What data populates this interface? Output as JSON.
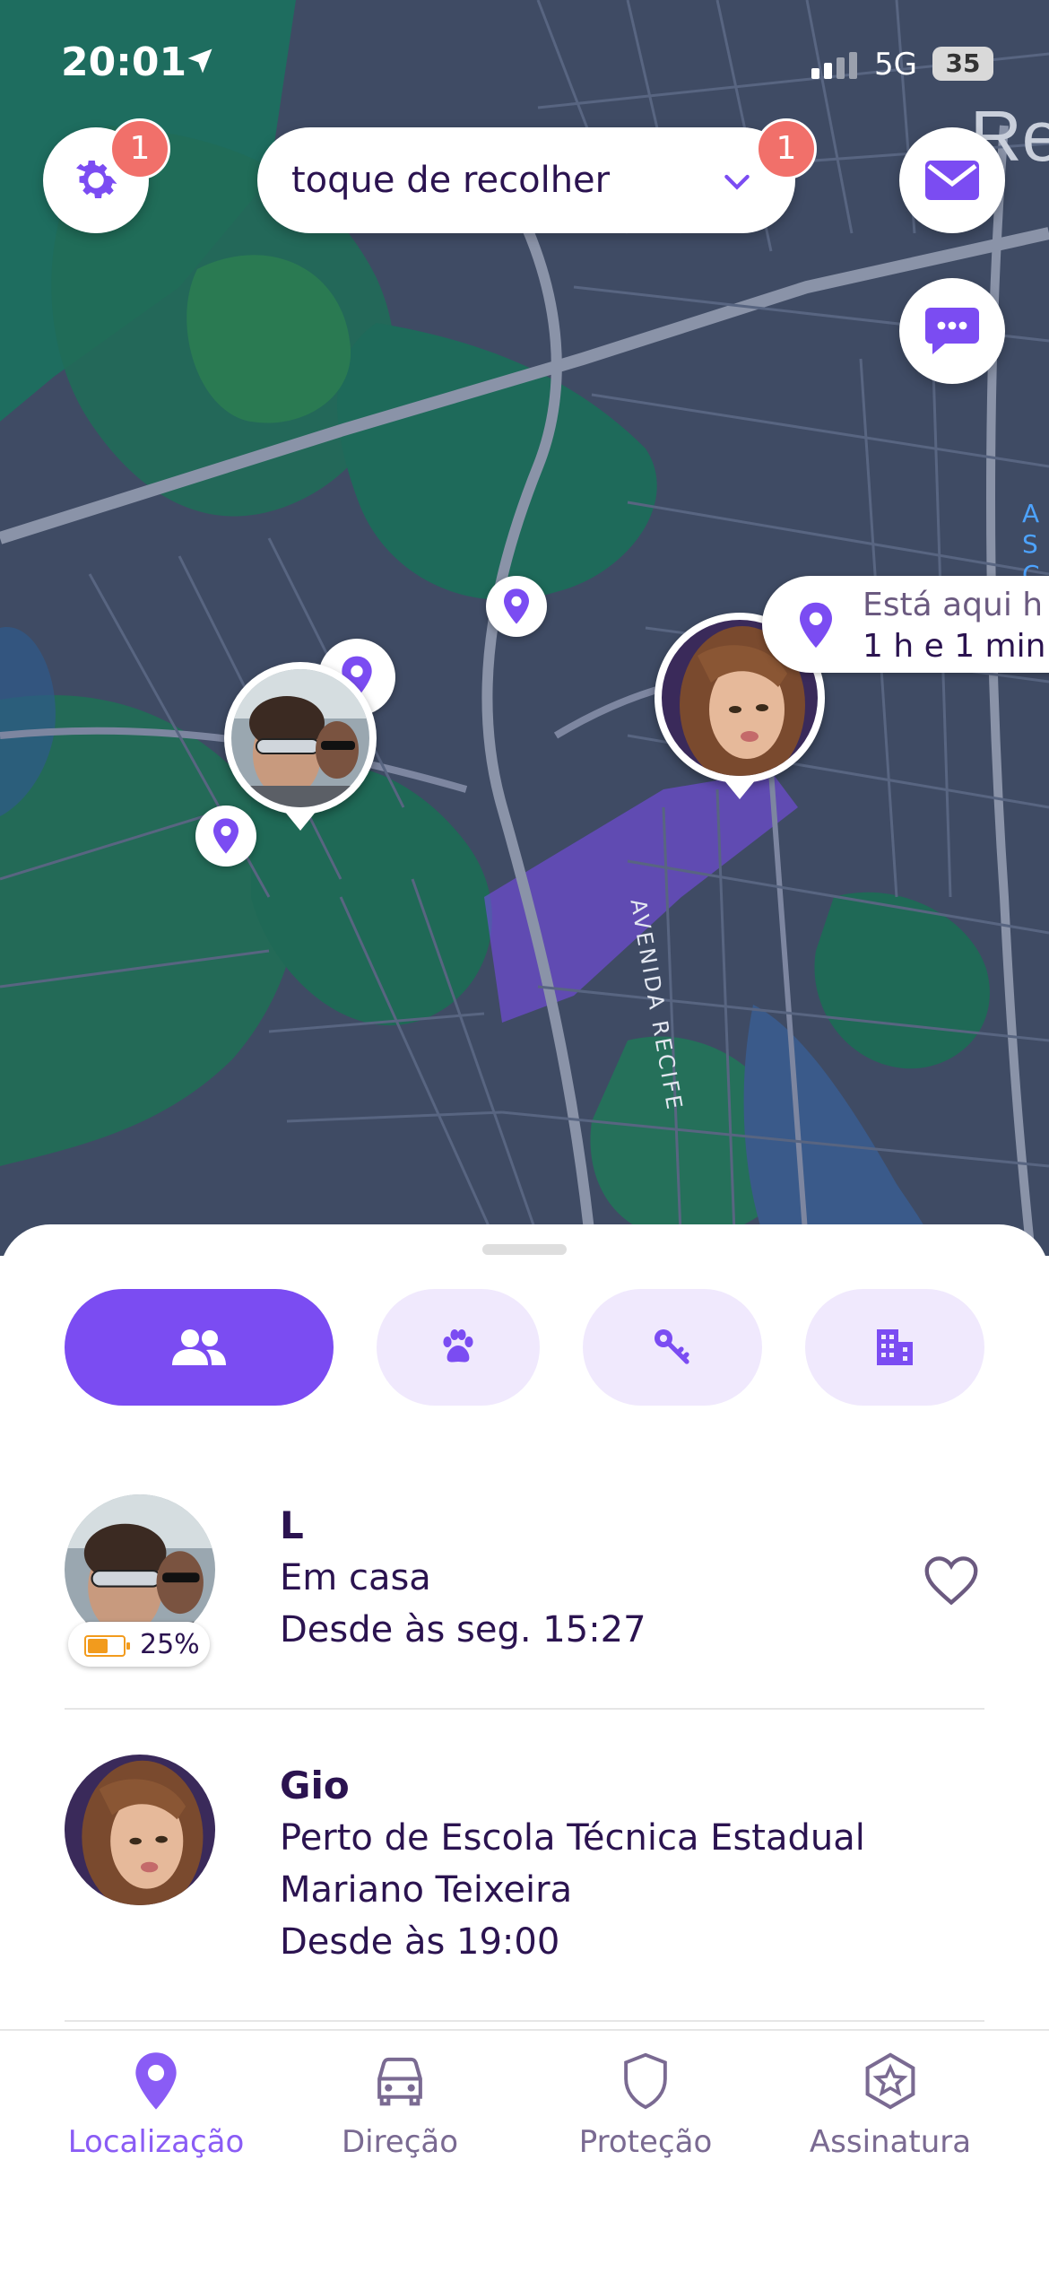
{
  "status_bar": {
    "time": "20:01",
    "network": "5G",
    "battery": "35"
  },
  "map": {
    "label_top_right": "Re",
    "street_label": "AVENIDA RECIFE",
    "side_label": "A S C"
  },
  "header": {
    "settings_badge": "1",
    "circle_dropdown": {
      "label": "toque de recolher",
      "badge": "1"
    }
  },
  "callout": {
    "line1": "Está aqui h",
    "line2": "1 h e 1 min"
  },
  "segments": [
    {
      "name": "people",
      "icon": "people-icon",
      "active": true
    },
    {
      "name": "pets",
      "icon": "paw-icon",
      "active": false
    },
    {
      "name": "items",
      "icon": "keys-icon",
      "active": false
    },
    {
      "name": "places",
      "icon": "building-icon",
      "active": false
    }
  ],
  "members": [
    {
      "name": "L",
      "location": "Em casa",
      "since": "Desde às seg. 15:27",
      "battery": "25%"
    },
    {
      "name": "Gio",
      "location_line1": "Perto de Escola Técnica Estadual",
      "location_line2": "Mariano Teixeira",
      "since": "Desde às 19:00"
    }
  ],
  "tabs": [
    {
      "label": "Localização",
      "icon": "location-pin-icon",
      "active": true
    },
    {
      "label": "Direção",
      "icon": "car-icon",
      "active": false
    },
    {
      "label": "Proteção",
      "icon": "shield-icon",
      "active": false
    },
    {
      "label": "Assinatura",
      "icon": "star-badge-icon",
      "active": false
    }
  ],
  "colors": {
    "accent": "#7b4cf2",
    "badge": "#f1706a",
    "map_base": "#3f4b64",
    "map_green": "#1f6b5e"
  }
}
